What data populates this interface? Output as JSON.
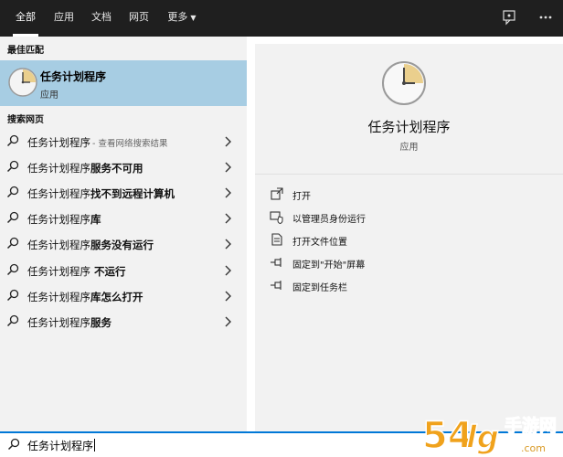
{
  "tabs": [
    {
      "label": "全部",
      "active": true
    },
    {
      "label": "应用"
    },
    {
      "label": "文档"
    },
    {
      "label": "网页"
    },
    {
      "label": "更多"
    }
  ],
  "sections": {
    "best_match": "最佳匹配",
    "web": "搜索网页"
  },
  "best_match": {
    "title": "任务计划程序",
    "subtitle": "应用"
  },
  "web_results": [
    {
      "prefix": "任务计划程序",
      "bold": "",
      "hint": "- 查看网络搜索结果"
    },
    {
      "prefix": "任务计划程序",
      "bold": "服务不可用",
      "hint": ""
    },
    {
      "prefix": "任务计划程序",
      "bold": "找不到远程计算机",
      "hint": ""
    },
    {
      "prefix": "任务计划程序",
      "bold": "库",
      "hint": ""
    },
    {
      "prefix": "任务计划程序",
      "bold": "服务没有运行",
      "hint": ""
    },
    {
      "prefix": "任务计划程序",
      "bold": " 不运行",
      "hint": ""
    },
    {
      "prefix": "任务计划程序",
      "bold": "库怎么打开",
      "hint": ""
    },
    {
      "prefix": "任务计划程序",
      "bold": "服务",
      "hint": ""
    }
  ],
  "detail": {
    "title": "任务计划程序",
    "subtitle": "应用",
    "actions": [
      {
        "label": "打开",
        "icon": "open-icon"
      },
      {
        "label": "以管理员身份运行",
        "icon": "shield-icon"
      },
      {
        "label": "打开文件位置",
        "icon": "file-location-icon"
      },
      {
        "label": "固定到\"开始\"屏幕",
        "icon": "pin-icon"
      },
      {
        "label": "固定到任务栏",
        "icon": "pin-icon"
      }
    ]
  },
  "search": {
    "value": "任务计划程序"
  },
  "watermark": {
    "digits": "54",
    "letters": "lg",
    "text": "手游网",
    "domain": ".com"
  },
  "colors": {
    "accent": "#0078d7",
    "selection": "#a7cde3",
    "tabbar": "#1f1f1f",
    "pane": "#f2f2f2"
  }
}
